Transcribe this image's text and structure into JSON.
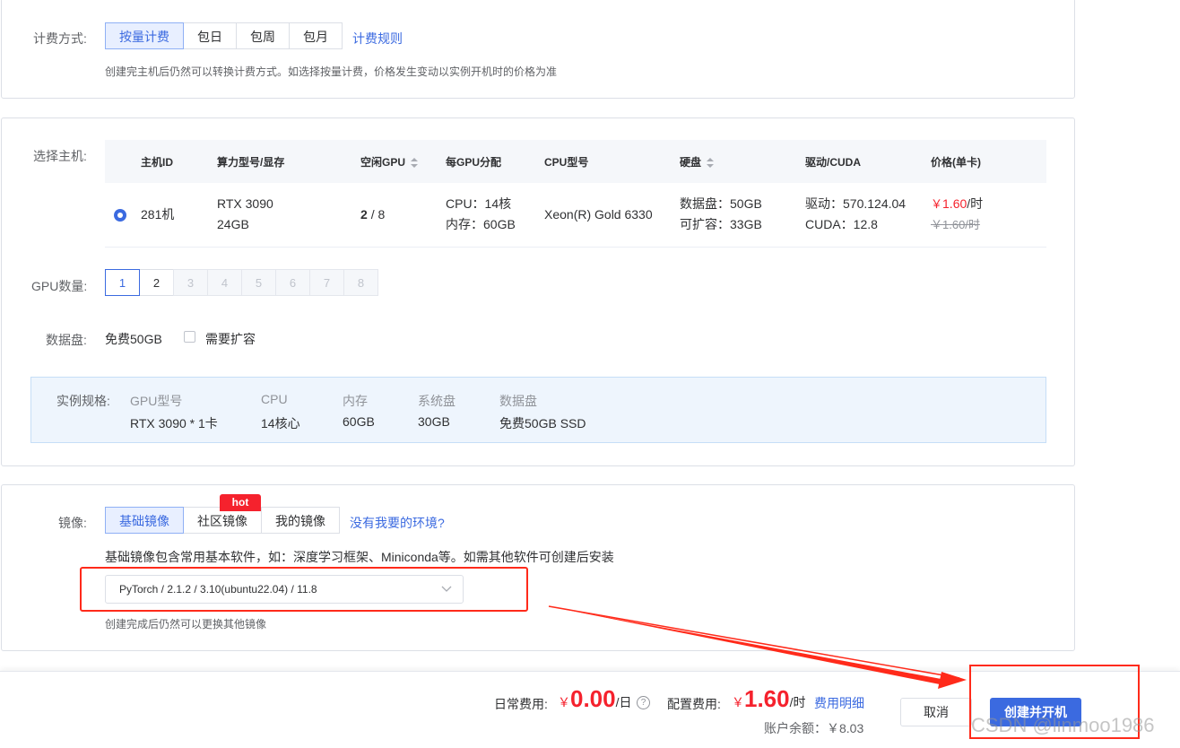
{
  "billing": {
    "label": "计费方式:",
    "options": [
      "按量计费",
      "包日",
      "包周",
      "包月"
    ],
    "rules_link": "计费规则",
    "hint": "创建完主机后仍然可以转换计费方式。如选择按量计费，价格发生变动以实例开机时的价格为准"
  },
  "host": {
    "label": "选择主机:",
    "columns": [
      "主机ID",
      "算力型号/显存",
      "空闲GPU",
      "每GPU分配",
      "CPU型号",
      "硬盘",
      "驱动/CUDA",
      "价格(单卡)"
    ],
    "row": {
      "id": "281机",
      "gpu_model": "RTX 3090",
      "gpu_mem": "24GB",
      "free_gpu_avail": "2",
      "free_gpu_total": "/ 8",
      "cpu_alloc": "CPU：14核",
      "mem_alloc": "内存：60GB",
      "cpu_model": "Xeon(R) Gold 6330",
      "disk_data": "数据盘：50GB",
      "disk_expand": "可扩容：33GB",
      "driver": "驱动：570.124.04",
      "cuda": "CUDA：12.8",
      "price_symbol": "￥",
      "price": "1.60",
      "price_unit": "/时",
      "price_old": "￥1.60/时"
    }
  },
  "gpu_count": {
    "label": "GPU数量:",
    "options": [
      "1",
      "2",
      "3",
      "4",
      "5",
      "6",
      "7",
      "8"
    ],
    "selected": "1"
  },
  "data_disk": {
    "label": "数据盘:",
    "free": "免费50GB",
    "expand_label": "需要扩容",
    "expand_checked": false
  },
  "spec": {
    "label": "实例规格:",
    "headers": [
      "GPU型号",
      "CPU",
      "内存",
      "系统盘",
      "数据盘"
    ],
    "values": [
      "RTX 3090 * 1卡",
      "14核心",
      "60GB",
      "30GB",
      "免费50GB SSD"
    ]
  },
  "image": {
    "label": "镜像:",
    "tabs": [
      "基础镜像",
      "社区镜像",
      "我的镜像"
    ],
    "hot_badge": "hot",
    "missing_link": "没有我要的环境?",
    "description": "基础镜像包含常用基本软件，如：深度学习框架、Miniconda等。如需其他软件可创建后安装",
    "selected": "PyTorch / 2.1.2 / 3.10(ubuntu22.04) / 11.8",
    "hint": "创建完成后仍然可以更换其他镜像"
  },
  "footer": {
    "daily_label": "日常费用:",
    "daily_symbol": "￥",
    "daily_value": "0.00",
    "daily_unit": "/日",
    "help_icon": "?",
    "config_label": "配置费用:",
    "config_symbol": "￥",
    "config_value": "1.60",
    "config_unit": "/时",
    "detail_link": "费用明细",
    "balance": "账户余额：￥8.03",
    "cancel": "取消",
    "create": "创建并开机"
  },
  "watermark": "CSDN @linmoo1986",
  "colors": {
    "accent": "#3b6ae0",
    "price_red": "#f5222d",
    "annotation_red": "#ff2a1a"
  }
}
